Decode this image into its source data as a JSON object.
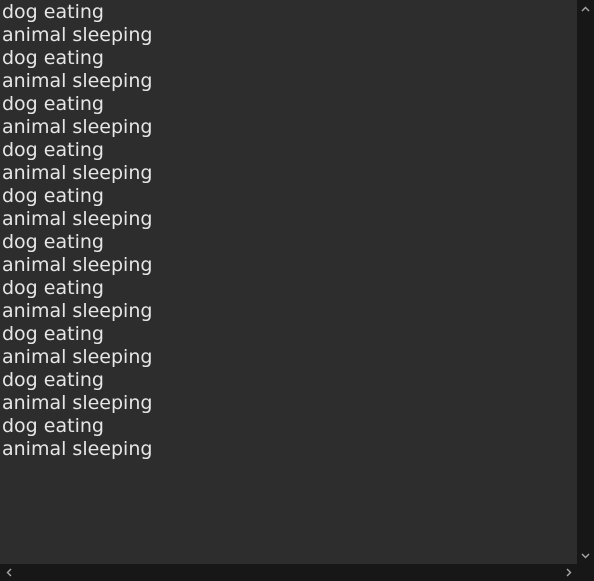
{
  "output": {
    "lines": [
      "dog eating",
      "animal sleeping",
      "dog eating",
      "animal sleeping",
      "dog eating",
      "animal sleeping",
      "dog eating",
      "animal sleeping",
      "dog eating",
      "animal sleeping",
      "dog eating",
      "animal sleeping",
      "dog eating",
      "animal sleeping",
      "dog eating",
      "animal sleeping",
      "dog eating",
      "animal sleeping",
      "dog eating",
      "animal sleeping"
    ]
  },
  "colors": {
    "background": "#2d2d2d",
    "text": "#e6e6e6",
    "scrollbar_track": "#171717",
    "scrollbar_arrow": "#a8a8a8"
  },
  "icons": {
    "scroll_up": "chevron-up-icon",
    "scroll_down": "chevron-down-icon",
    "scroll_left": "chevron-left-icon",
    "scroll_right": "chevron-right-icon"
  }
}
